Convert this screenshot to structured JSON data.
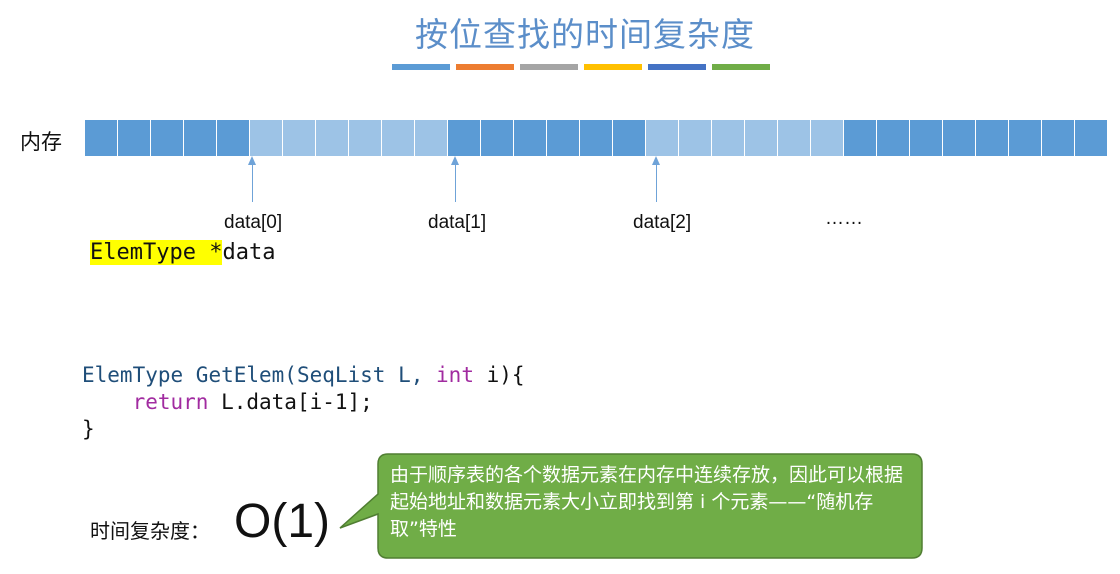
{
  "title": "按位查找的时间复杂度",
  "title_color": "#5b8ec9",
  "strip_colors": [
    "#5b9bd5",
    "#ed7d31",
    "#a5a5a5",
    "#ffc000",
    "#4472c4",
    "#70ad47"
  ],
  "memory": {
    "label": "内存",
    "cells": [
      "dark",
      "dark",
      "dark",
      "dark",
      "dark",
      "light",
      "light",
      "light",
      "light",
      "light",
      "light",
      "dark",
      "dark",
      "dark",
      "dark",
      "dark",
      "dark",
      "light",
      "light",
      "light",
      "light",
      "light",
      "light",
      "dark",
      "dark",
      "dark",
      "dark",
      "dark",
      "dark",
      "dark",
      "dark"
    ],
    "dark_color": "#5b9bd5",
    "light_color": "#9dc3e6",
    "index_labels": [
      "data[0]",
      "data[1]",
      "data[2]",
      "……"
    ]
  },
  "declaration": {
    "type_part": "ElemType *",
    "name_part": "data",
    "highlight_color": "#ffff00"
  },
  "code": {
    "type1": "ElemType",
    "fn": " GetElem(SeqList L, ",
    "int_kw": "int",
    "param": " i){",
    "indent": "    ",
    "ret_kw": "return",
    "ret_rest": " L.data[i-1];",
    "close": "}"
  },
  "complexity": {
    "label": "时间复杂度：",
    "value": "O(1)"
  },
  "callout": {
    "text": "由于顺序表的各个数据元素在内存中连续存放，因此可以根据起始地址和数据元素大小立即找到第 i 个元素——“随机存取”特性",
    "fill": "#70ad47",
    "stroke": "#507e32"
  }
}
